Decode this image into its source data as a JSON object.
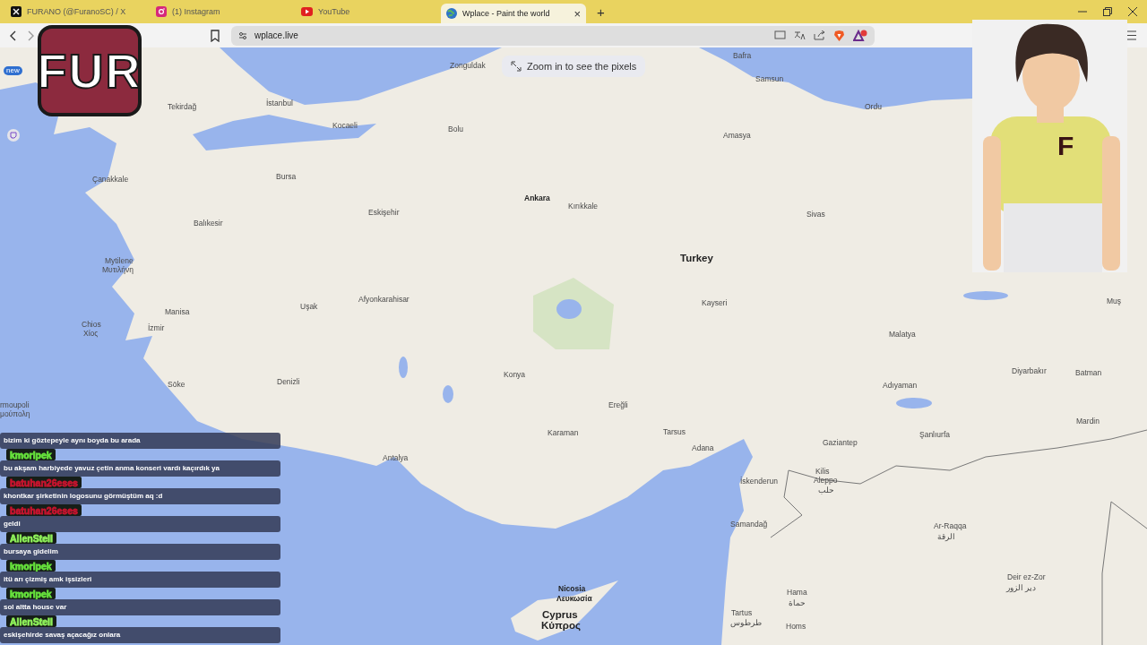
{
  "window_tabs": [
    {
      "kind": "x",
      "title": "FURANO (@FuranoSC) / X",
      "selected": false
    },
    {
      "kind": "camera",
      "title": "(1) Instagram",
      "selected": false
    },
    {
      "kind": "play",
      "title": "YouTube",
      "selected": false
    },
    {
      "kind": "globe",
      "title": "Wplace - Paint the world",
      "selected": true
    }
  ],
  "tab_close": "×",
  "new_tab": "+",
  "toolbar": {
    "address": "wplace.live"
  },
  "side_badge": "new",
  "zoom_hint": "Zoom in to see the pixels",
  "logo": {
    "text": "FUR"
  },
  "character": {
    "shirt_letter": "F"
  },
  "map": {
    "labels": [
      {
        "text": "Zonguldak",
        "kind": "city"
      },
      {
        "text": "Bafra",
        "kind": "city"
      },
      {
        "text": "Samsun",
        "kind": "city"
      },
      {
        "text": "Tekirdağ",
        "kind": "city"
      },
      {
        "text": "İstanbul",
        "kind": "city"
      },
      {
        "text": "Ordu",
        "kind": "city"
      },
      {
        "text": "Kocaeli",
        "kind": "city"
      },
      {
        "text": "Bolu",
        "kind": "city"
      },
      {
        "text": "Amasya",
        "kind": "city"
      },
      {
        "text": "Çanakkale",
        "kind": "city"
      },
      {
        "text": "Bursa",
        "kind": "city"
      },
      {
        "text": "Eskişehir",
        "kind": "city"
      },
      {
        "text": "Ankara",
        "kind": "capital"
      },
      {
        "text": "Kırıkkale",
        "kind": "city"
      },
      {
        "text": "Sivas",
        "kind": "city"
      },
      {
        "text": "Balıkesir",
        "kind": "city"
      },
      {
        "text": "Mytilene",
        "kind": "city"
      },
      {
        "text": "Turkey",
        "kind": "country"
      },
      {
        "text": "Μυτιλήνη",
        "kind": "city"
      },
      {
        "text": "Manisa",
        "kind": "city"
      },
      {
        "text": "Uşak",
        "kind": "city"
      },
      {
        "text": "Afyonkarahisar",
        "kind": "city"
      },
      {
        "text": "Kayseri",
        "kind": "city"
      },
      {
        "text": "Muş",
        "kind": "city"
      },
      {
        "text": "Chios",
        "kind": "city"
      },
      {
        "text": "Χίος",
        "kind": "city"
      },
      {
        "text": "İzmir",
        "kind": "city"
      },
      {
        "text": "Malatya",
        "kind": "city"
      },
      {
        "text": "Konya",
        "kind": "city"
      },
      {
        "text": "Diyarbakır",
        "kind": "city"
      },
      {
        "text": "Batman",
        "kind": "city"
      },
      {
        "text": "Söke",
        "kind": "city"
      },
      {
        "text": "Denizli",
        "kind": "city"
      },
      {
        "text": "Adıyaman",
        "kind": "city"
      },
      {
        "text": "rmoupoli",
        "kind": "city"
      },
      {
        "text": "μούπολη",
        "kind": "city"
      },
      {
        "text": "Ereğli",
        "kind": "city"
      },
      {
        "text": "Mardin",
        "kind": "city"
      },
      {
        "text": "Karaman",
        "kind": "city"
      },
      {
        "text": "Tarsus",
        "kind": "city"
      },
      {
        "text": "Şanlıurfa",
        "kind": "city"
      },
      {
        "text": "Antalya",
        "kind": "city"
      },
      {
        "text": "Adana",
        "kind": "city"
      },
      {
        "text": "Gaziantep",
        "kind": "city"
      },
      {
        "text": "Kilis",
        "kind": "city"
      },
      {
        "text": "İskenderun",
        "kind": "city"
      },
      {
        "text": "Aleppo",
        "kind": "city"
      },
      {
        "text": "حلب",
        "kind": "city"
      },
      {
        "text": "Samandağ",
        "kind": "city"
      },
      {
        "text": "Ar-Raqqa",
        "kind": "city"
      },
      {
        "text": "الرقة",
        "kind": "city"
      },
      {
        "text": "Deir ez-Zor",
        "kind": "city"
      },
      {
        "text": "Nicosia",
        "kind": "capital"
      },
      {
        "text": "Hama",
        "kind": "city"
      },
      {
        "text": "دير الزور",
        "kind": "city"
      },
      {
        "text": "Λευκωσία",
        "kind": "capital"
      },
      {
        "text": "حماة",
        "kind": "city"
      },
      {
        "text": "Cyprus",
        "kind": "country"
      },
      {
        "text": "Tartus",
        "kind": "city"
      },
      {
        "text": "Κύπρος",
        "kind": "country"
      },
      {
        "text": "طرطوس",
        "kind": "city"
      },
      {
        "text": "Homs",
        "kind": "city"
      }
    ]
  },
  "chat": {
    "messages": [
      {
        "text": "bizim ki göztepeyle aynı boyda bu arada"
      },
      {
        "user": "kmorlpek",
        "color": "#66e23c",
        "text": "bu akşam harbiyede yavuz çetin anma konseri vardı kaçırdık ya"
      },
      {
        "user": "batuhan26eses",
        "color": "#c8142e",
        "text": "khontkar şirketinin logosunu görmüştüm aq :d"
      },
      {
        "user": "batuhan26eses",
        "color": "#c8142e",
        "text": "geldi"
      },
      {
        "user": "AlienStell",
        "color": "#8ef05a",
        "text": "bursaya gidelim"
      },
      {
        "user": "kmorlpek",
        "color": "#66e23c",
        "text": "itü arı çizmiş amk işsizleri"
      },
      {
        "user": "kmorlpek",
        "color": "#66e23c",
        "text": "sol altta house var"
      },
      {
        "user": "AlienStell",
        "color": "#8ef05a",
        "text": "eskişehirde savaş açacağız onlara"
      }
    ]
  }
}
